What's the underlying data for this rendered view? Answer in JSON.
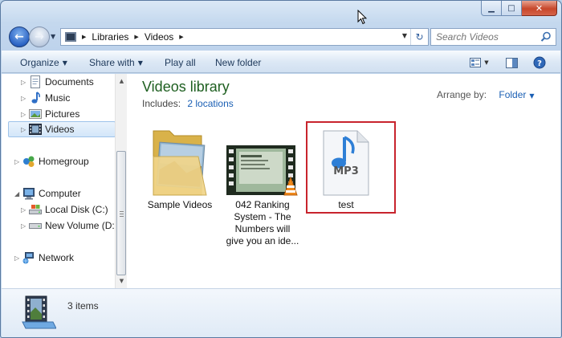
{
  "window": {
    "caption": {
      "minimize": "▁",
      "maximize": "□",
      "close": "✕"
    }
  },
  "address": {
    "segments": [
      "Libraries",
      "Videos"
    ]
  },
  "search": {
    "placeholder": "Search Videos"
  },
  "toolbar": {
    "organize": "Organize",
    "share_with": "Share with",
    "play_all": "Play all",
    "new_folder": "New folder"
  },
  "nav": {
    "libraries": [
      {
        "label": "Documents",
        "icon": "documents-icon"
      },
      {
        "label": "Music",
        "icon": "music-icon"
      },
      {
        "label": "Pictures",
        "icon": "pictures-icon"
      },
      {
        "label": "Videos",
        "icon": "videos-icon",
        "selected": true
      }
    ],
    "homegroup": "Homegroup",
    "computer": "Computer",
    "drives": [
      {
        "label": "Local Disk (C:)"
      },
      {
        "label": "New Volume (D:)"
      }
    ],
    "network": "Network"
  },
  "library": {
    "title": "Videos library",
    "includes_label": "Includes:",
    "locations_link": "2 locations",
    "arrange_label": "Arrange by:",
    "arrange_value": "Folder"
  },
  "files": [
    {
      "name": "Sample Videos",
      "type": "folder"
    },
    {
      "name_lines": [
        "042 Ranking",
        "System - The",
        "Numbers will",
        "give you an ide..."
      ],
      "type": "video"
    },
    {
      "name": "test",
      "type": "mp3",
      "badge": "MP3"
    }
  ],
  "details": {
    "count": "3 items"
  },
  "colors": {
    "library_title": "#1e5f20",
    "link": "#1a5fb4",
    "highlight": "#c8242d"
  }
}
